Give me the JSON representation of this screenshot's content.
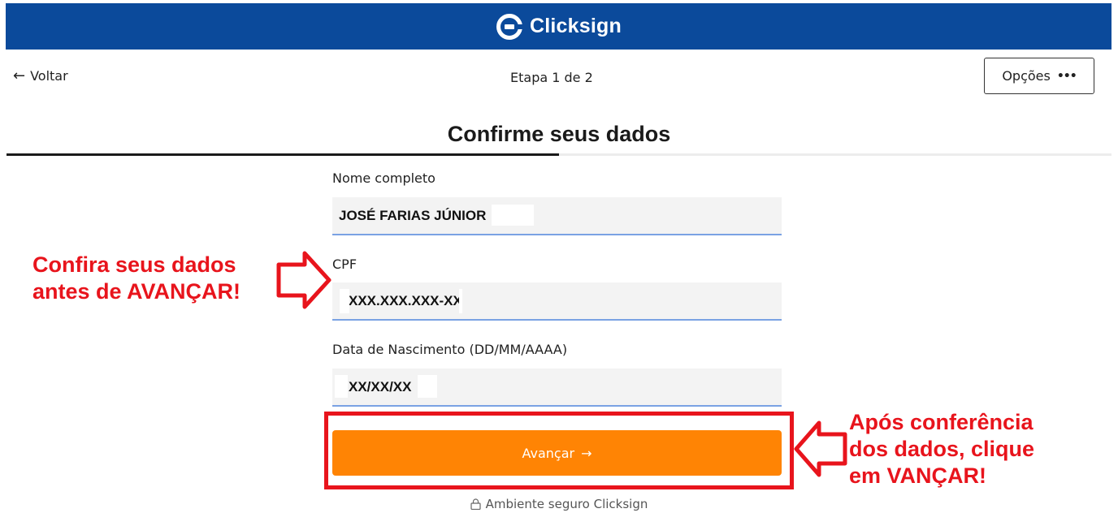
{
  "header": {
    "brand": "Clicksign"
  },
  "nav": {
    "back_label": "Voltar",
    "step_label": "Etapa 1 de 2",
    "options_label": "Opções",
    "progress_fraction": 0.5
  },
  "form": {
    "title": "Confirme seus dados",
    "fields": [
      {
        "label": "Nome completo",
        "value": "JOSÉ FARIAS JÚNIOR"
      },
      {
        "label": "CPF",
        "value": "XXX.XXX.XXX-XX"
      },
      {
        "label": "Data de Nascimento (DD/MM/AAAA)",
        "value": "XX/XX/XX"
      }
    ],
    "submit_label": "Avançar"
  },
  "footer": {
    "secure_label": "Ambiente seguro Clicksign"
  },
  "annotations": {
    "left_line1": "Confira seus dados",
    "left_line2": "antes de AVANÇAR!",
    "right_line1": "Após conferência",
    "right_line2": "dos dados, clique",
    "right_line3": "em VANÇAR!"
  },
  "colors": {
    "header_bg": "#0b4a9b",
    "button_bg": "#ff8404",
    "annotation_red": "#e8141c",
    "field_underline": "#7aa2e3"
  }
}
